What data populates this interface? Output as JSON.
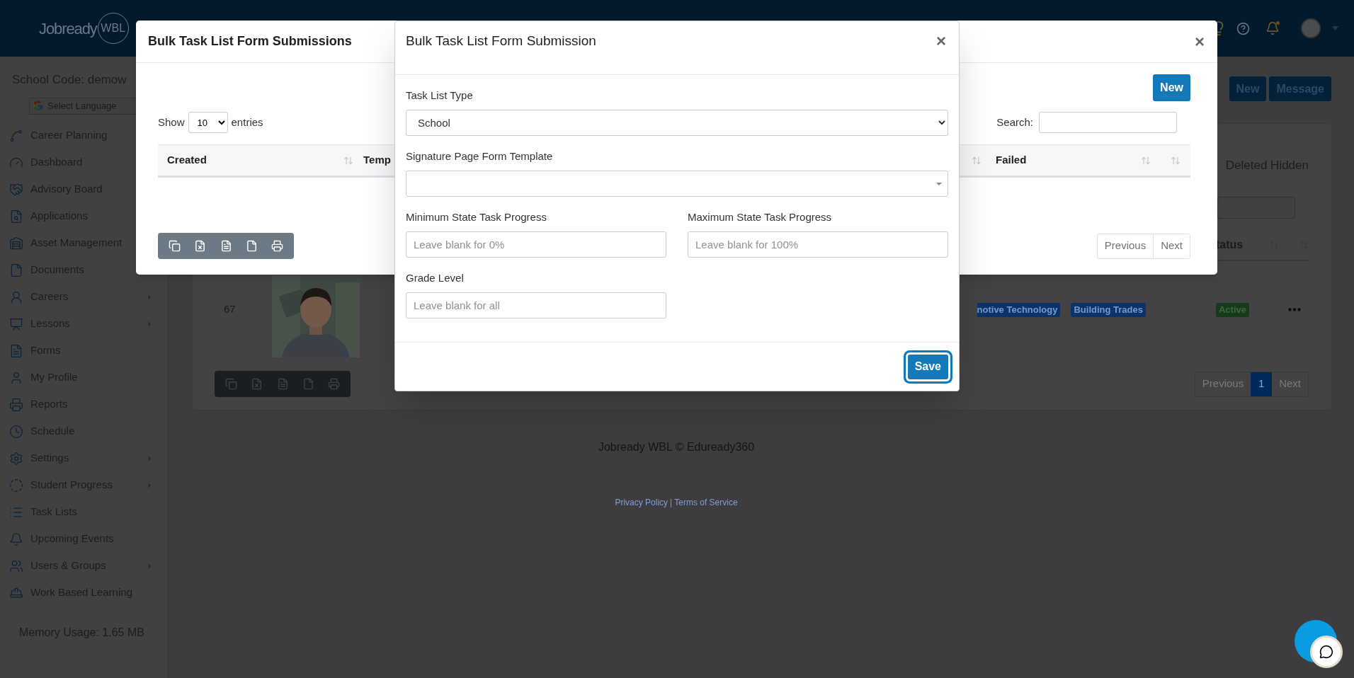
{
  "header": {
    "logo_text": "Jobready",
    "logo_badge": "WBL"
  },
  "sidebar": {
    "school_code": "School Code: demow",
    "language": "Select Language",
    "items": [
      {
        "label": "Career Planning"
      },
      {
        "label": "Dashboard"
      },
      {
        "label": "Advisory Board"
      },
      {
        "label": "Applications"
      },
      {
        "label": "Asset Management"
      },
      {
        "label": "Documents"
      },
      {
        "label": "Careers",
        "submenu": true
      },
      {
        "label": "Lessons",
        "submenu": true
      },
      {
        "label": "Forms",
        "submenu": false
      },
      {
        "label": "My Profile",
        "submenu": false
      },
      {
        "label": "Reports",
        "submenu": false
      },
      {
        "label": "Schedule",
        "submenu": false
      },
      {
        "label": "Settings",
        "submenu": true
      },
      {
        "label": "Student Progress",
        "submenu": true
      },
      {
        "label": "Task Lists",
        "submenu": false
      },
      {
        "label": "Upcoming Events",
        "submenu": false
      },
      {
        "label": "Users & Groups",
        "submenu": true
      },
      {
        "label": "Work Based Learning",
        "submenu": false
      }
    ],
    "memory": "Memory Usage: 1.65 MB"
  },
  "page": {
    "buttons": [
      "New",
      "Message"
    ],
    "filter_text": "Deleted Hidden",
    "column_last": "tatus",
    "rows": [
      {
        "id": "67",
        "tags": [
          "notive Technology",
          "Building Trades"
        ],
        "status": "Active"
      }
    ],
    "pagination": {
      "previous": "Previous",
      "pages": [
        {
          "label": "1",
          "selected": true
        }
      ],
      "next": "Next"
    }
  },
  "footer": {
    "copyright": "Jobready WBL © Eduready360",
    "links": [
      "Privacy Policy",
      "Terms of Service"
    ],
    "separator": "|"
  },
  "submissions_modal": {
    "title": "Bulk Task List Form Submissions",
    "close": "×",
    "new_button": "New",
    "show": "Show",
    "entries_value": "10",
    "entries": "entries",
    "search_label": "Search:",
    "columns_left": [
      "Created",
      "Temp"
    ],
    "columns_right": [
      "Failed"
    ],
    "pagination": {
      "previous": "Previous",
      "next": "Next"
    }
  },
  "form_modal": {
    "title": "Bulk Task List Form Submission",
    "close": "×",
    "fields": [
      {
        "kind": "select",
        "label": "Task List Type",
        "value": "School"
      },
      {
        "kind": "combo",
        "label": "Signature Page Form Template"
      },
      {
        "kind": "text",
        "label": "Minimum State Task Progress",
        "placeholder": "Leave blank for 0%"
      },
      {
        "kind": "text",
        "label": "Maximum State Task Progress",
        "placeholder": "Leave blank for 100%"
      },
      {
        "kind": "text",
        "label": "Grade Level",
        "placeholder": "Leave blank for all"
      }
    ],
    "save": "Save"
  }
}
